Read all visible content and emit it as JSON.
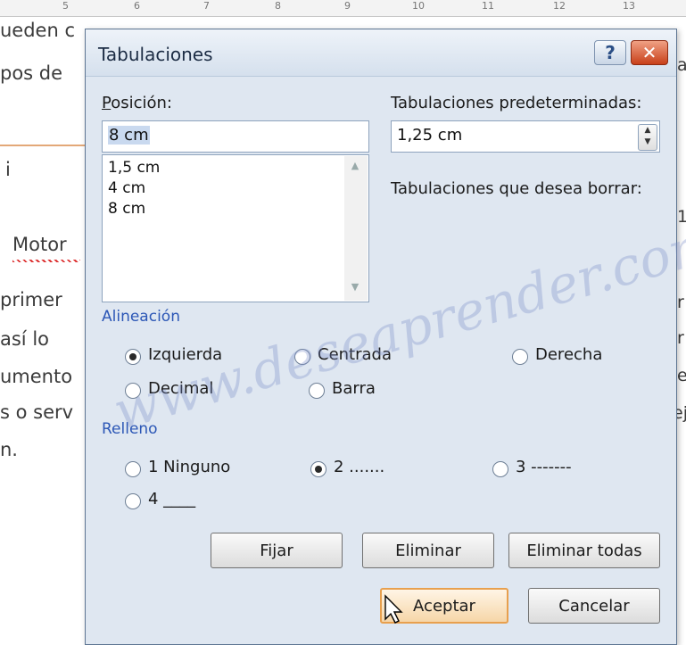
{
  "background_doc": {
    "ruler_numbers": [
      "5",
      "6",
      "7",
      "8",
      "9",
      "10",
      "11",
      "12",
      "13"
    ],
    "lines": [
      "ueden c",
      "pos de",
      "i",
      "Motor",
      "primer",
      "así lo",
      "umento",
      "s o serv",
      "n."
    ],
    "right_chars": [
      "a",
      "1",
      "r",
      "r",
      "e",
      "ej"
    ]
  },
  "dialog": {
    "title": "Tabulaciones",
    "help_glyph": "?",
    "close_glyph": "✕",
    "position": {
      "label": "Posición:",
      "value": "8 cm",
      "list": [
        "1,5 cm",
        "4 cm",
        "8 cm"
      ]
    },
    "default_tabs": {
      "label": "Tabulaciones predeterminadas:",
      "value": "1,25 cm"
    },
    "clear_label": "Tabulaciones que desea borrar:",
    "alignment": {
      "title": "Alineación",
      "options": [
        "Izquierda",
        "Centrada",
        "Derecha",
        "Decimal",
        "Barra"
      ],
      "selected": "Izquierda"
    },
    "leader": {
      "title": "Relleno",
      "options": [
        "1 Ninguno",
        "2 .......",
        "3 -------",
        "4 ____"
      ],
      "selected": "2 ......."
    },
    "buttons": {
      "set": "Fijar",
      "clear": "Eliminar",
      "clear_all": "Eliminar todas",
      "ok": "Aceptar",
      "cancel": "Cancelar"
    }
  },
  "watermark": "www.deseaprender.com",
  "colors": {
    "section_title": "#2c57b6",
    "close_button": "#c8401a",
    "default_button_border": "#e8a04e"
  }
}
